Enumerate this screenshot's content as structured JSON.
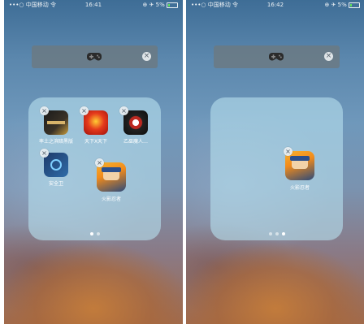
{
  "status_bar": {
    "carrier_left": "•••○ 中国移动 令",
    "time_left": "16:41",
    "carrier_right": "•••○ 中国移动 令",
    "time_right": "16:42",
    "right_icons": "⊕ ✈ 5%"
  },
  "dock_bar": {
    "icon": "gamepad-icon",
    "close_icon": "close-icon"
  },
  "left_folder": {
    "apps": [
      {
        "label": "率土之滨暗黑版",
        "icon": "app-icon"
      },
      {
        "label": "天下X天下",
        "icon": "app-icon"
      },
      {
        "label": "乙巫魔人…",
        "icon": "app-icon"
      },
      {
        "label": "安全卫",
        "icon": "app-icon"
      },
      {
        "label": "火影忍者",
        "icon": "app-icon"
      }
    ],
    "page_dots": 2,
    "active_page": 1
  },
  "right_folder": {
    "apps": [
      {
        "label": "火影忍者",
        "icon": "app-icon"
      }
    ],
    "page_dots": 3,
    "active_page": 3
  },
  "delete_glyph": "×"
}
